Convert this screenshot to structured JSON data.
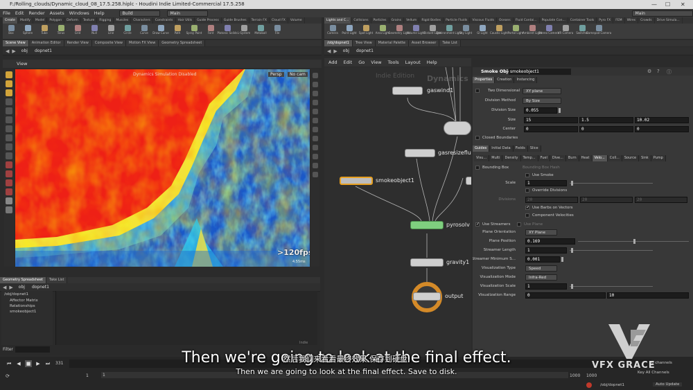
{
  "window": {
    "title": "F:/Rolling_clouds/Dynamic_cloud_08_17.5.258.hiplc - Houdini Indie Limited-Commercial 17.5.258",
    "min": "—",
    "max": "☐",
    "close": "✕"
  },
  "menu": [
    "File",
    "Edit",
    "Render",
    "Assets",
    "Windows",
    "Help"
  ],
  "desktops": {
    "left": "Build",
    "right_top": "Main",
    "right": "Main"
  },
  "left_shelf_tabs": [
    "Create",
    "Modify",
    "Model",
    "Polygon",
    "Deform",
    "Texture",
    "Rigging",
    "Muscles",
    "Characters",
    "Constraints",
    "Hair Utils",
    "Guide Process",
    "Guide Brushes",
    "Terrain FX",
    "Cloud FX",
    "Volume"
  ],
  "left_tools": [
    "Box",
    "Sphere",
    "Tube",
    "Torus",
    "Grid",
    "Null",
    "Line",
    "Circle",
    "Curve",
    "Draw Curve",
    "Path",
    "Spray Paint",
    "Font",
    "Platonic Solids",
    "L-System",
    "Metaball",
    "File"
  ],
  "right_shelf_tabs": [
    "Lights and C...",
    "Collisions",
    "Particles",
    "Grains",
    "Vellum",
    "Rigid Bodies",
    "Particle Fluids",
    "Viscous Fluids",
    "Oceans",
    "Fluid Contai...",
    "Populate Con...",
    "Container Tools",
    "Pyro FX",
    "FEM",
    "Wires",
    "Crowds",
    "Drive Simula..."
  ],
  "right_tools": [
    "Camera",
    "Point Light",
    "Spot Light",
    "Area Light",
    "Geometry Light",
    "Volume Light",
    "Distant Light",
    "Environment Light",
    "Sky Light",
    "GI Light",
    "Caustic Light",
    "Portal Light",
    "Ambient Light",
    "Stereo Camera",
    "VR Camera",
    "Switcher",
    "Gamepad Camera"
  ],
  "left_pane_tabs": [
    "Scene View",
    "Animation Editor",
    "Render View",
    "Composite View",
    "Motion FX View",
    "Geometry Spreadsheet"
  ],
  "left_path": [
    "obj",
    "dopnet1"
  ],
  "viewport": {
    "menu_label": "View",
    "overlay_note": "Dynamics Simulation Disabled",
    "persp": "Persp",
    "camera": "No cam",
    "fps": ">120fps",
    "time": "4.55ms"
  },
  "right_pane_tabs": [
    "/obj/dopnet1",
    "Tree View",
    "Material Palette",
    "Asset Browser",
    "Take List"
  ],
  "right_path": [
    "obj",
    "dopnet1"
  ],
  "net_menu": [
    "Add",
    "Edit",
    "Go",
    "View",
    "Tools",
    "Layout",
    "Help"
  ],
  "net": {
    "watermark1": "Indie Edition",
    "watermark2": "Dynamics"
  },
  "nodes": {
    "gaswind": "gaswind1",
    "gasresize": "gasresizeflu",
    "smoke": "smokeobject1",
    "pyro": "pyrosolv",
    "gravity": "gravity1",
    "output": "output"
  },
  "params": {
    "node_type": "Smoke Object",
    "node_name": "smokeobject1",
    "tabs": [
      "Properties",
      "Creation",
      "Instancing"
    ],
    "rows": {
      "two_dim": {
        "label": "Two Dimensional",
        "value": "XY plane"
      },
      "division_method": {
        "label": "Division Method",
        "value": "By Size"
      },
      "division_size": {
        "label": "Division Size",
        "value": "0.055"
      },
      "size": {
        "label": "Size",
        "x": "15",
        "y": "1.5",
        "z": "10.02"
      },
      "center": {
        "label": "Center",
        "x": "0",
        "y": "0",
        "z": "0"
      },
      "closed": {
        "label": "Closed Boundaries"
      }
    },
    "sub_tabs": [
      "Guides",
      "Initial Data",
      "Fields",
      "Slice"
    ],
    "vis_tabs": [
      "Visu...",
      "Multi",
      "Density",
      "Temp...",
      "Fuel",
      "Dive...",
      "Burn",
      "Heat",
      "Velo...",
      "Coll...",
      "Source",
      "Sink",
      "Pump"
    ],
    "guides": {
      "bounding_box": "Bounding Box",
      "bounding_box_hash": "Bounding Box Hash",
      "use_smoke": "Use Smoke",
      "scale_label": "Scale",
      "scale_value": "1",
      "override_div": "Override Divisions",
      "divisions_label": "Divisions",
      "div_values": [
        "20",
        "20",
        "20"
      ],
      "use_barbs": "Use Barbs on Vectors",
      "component_vel": "Component Velocities",
      "use_streamers": "Use Streamers",
      "use_plane": "Use Plane",
      "plane_orient_label": "Plane Orientation",
      "plane_orient_value": "XY Plane",
      "plane_pos_label": "Plane Position",
      "plane_pos_value": "0.169",
      "streamer_len_label": "Streamer Length",
      "streamer_len_value": "1",
      "streamer_min_label": "Streamer Minimum S...",
      "streamer_min_value": "0.001",
      "vis_type_label": "Visualization Type",
      "vis_type_value": "Speed",
      "vis_mode_label": "Visualization Mode",
      "vis_mode_value": "Infra-Red",
      "vis_scale_label": "Visualization Scale",
      "vis_scale_value": "1",
      "vis_range_label": "Visualization Range",
      "vis_range_min": "0",
      "vis_range_max": "10"
    }
  },
  "geo": {
    "tabs": [
      "Geometry Spreadsheet",
      "Take List"
    ],
    "path": [
      "obj",
      "dopnet1"
    ],
    "tree": [
      "/obj/dopnet1",
      "Affector Matrix",
      "Relationships",
      "smokeobject1"
    ],
    "filter_label": "Filter",
    "status": "Indie"
  },
  "timeline": {
    "frame": "331",
    "start": "1",
    "start2": "1",
    "end": "1000",
    "end2": "1000",
    "channels": "0 channels",
    "keys": "Key All Channels",
    "net_path": "/obj/dopnet1",
    "auto_update": "Auto Update"
  },
  "subtitles": {
    "big": "Then we're going to look at the final effect.",
    "cn": "然后我们来看看最终效果,保存到硬盘,",
    "en": "Then we are going to look at the final effect. Save to disk."
  },
  "logo": {
    "text": "VFX GRACE"
  },
  "colors": {
    "accent": "#f0a020",
    "node_green": "#6fc06f",
    "output_orange": "#e8a030"
  }
}
